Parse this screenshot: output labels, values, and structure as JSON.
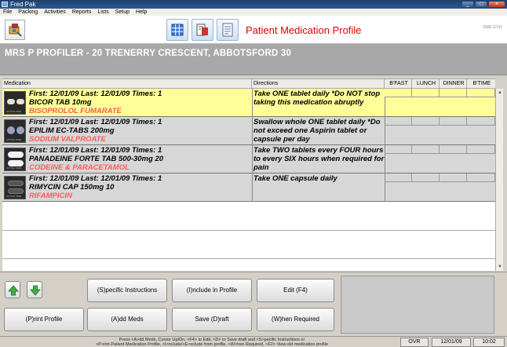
{
  "window": {
    "title": "Fred Pak"
  },
  "menu": [
    "File",
    "Packing",
    "Activities",
    "Reports",
    "Lists",
    "Setup",
    "Help"
  ],
  "header": {
    "title": "Patient Medication Profile",
    "stamp": "2008 12:31"
  },
  "patient": {
    "banner": "MRS P PROFILER - 20 TRENERRY CRESCENT, ABBOTSFORD  30"
  },
  "columns": {
    "medication": "Medication",
    "directions": "Directions",
    "bfast": "B'FAST",
    "lunch": "LUNCH",
    "dinner": "DINNER",
    "btime": "B'TIME"
  },
  "rows": [
    {
      "line1": "First: 12/01/09 Last: 12/01/09 Times: 1",
      "line2": "BICOR TAB 10mg",
      "generic": "BISOPROLOL FUMARATE",
      "directions": "Take ONE tablet daily *Do NOT stop taking this medication abruptly",
      "selected": true
    },
    {
      "line1": "First: 12/01/09 Last: 12/01/09 Times: 1",
      "line2": "EPILIM EC-TABS 200mg",
      "generic": "SODIUM VALPROATE",
      "directions": "Swallow whole ONE tablet daily *Do not exceed one Aspirin tablet or capsule per day",
      "selected": false
    },
    {
      "line1": "First: 12/01/09 Last: 12/01/09 Times: 1",
      "line2": "PANADEINE FORTE TAB 500-30mg 20",
      "generic": "CODEINE & PARACETAMOL",
      "directions": "Take TWO tablets every FOUR hours to every SIX hours when required for pain",
      "selected": false
    },
    {
      "line1": "First: 12/01/09 Last: 12/01/09 Times: 1",
      "line2": "RIMYCIN CAP 150mg 10",
      "generic": "RIFAMPICIN",
      "directions": "Take ONE capsule daily",
      "selected": false
    }
  ],
  "buttons": {
    "specific": "(S)pecific Instructions",
    "include": "(I)nclude in Profile",
    "edit": "Edit (F4)",
    "print": "(P)rint Profile",
    "add": "(A)dd Meds",
    "save": "Save (D)raft",
    "when": "(W)hen Required"
  },
  "status": {
    "help1": "Press <A>dd Meds, Cursor Up/Dn, <F4> to Edit, <D> to Save draft and <S>pecific Instructions or",
    "help2": "<P>rint Patient Medication Profile, <I>nclude/<E>xclude from profile, <W>hen Required, <F2> View old medication profile",
    "ovr": "OVR",
    "date": "12/01/09",
    "time": "10:02"
  },
  "icons": {
    "app": "app-icon",
    "logo": "pharmacy-logo-icon",
    "grid": "grid-icon",
    "toolbox": "toolbox-icon",
    "profile": "profile-sheet-icon",
    "up": "arrow-up-icon",
    "down": "arrow-down-icon"
  },
  "colors": {
    "accent_title": "#e00000",
    "selected_row": "#ffff99",
    "generic_name": "#ff5a5a",
    "arrow_green": "#3fae3f"
  }
}
